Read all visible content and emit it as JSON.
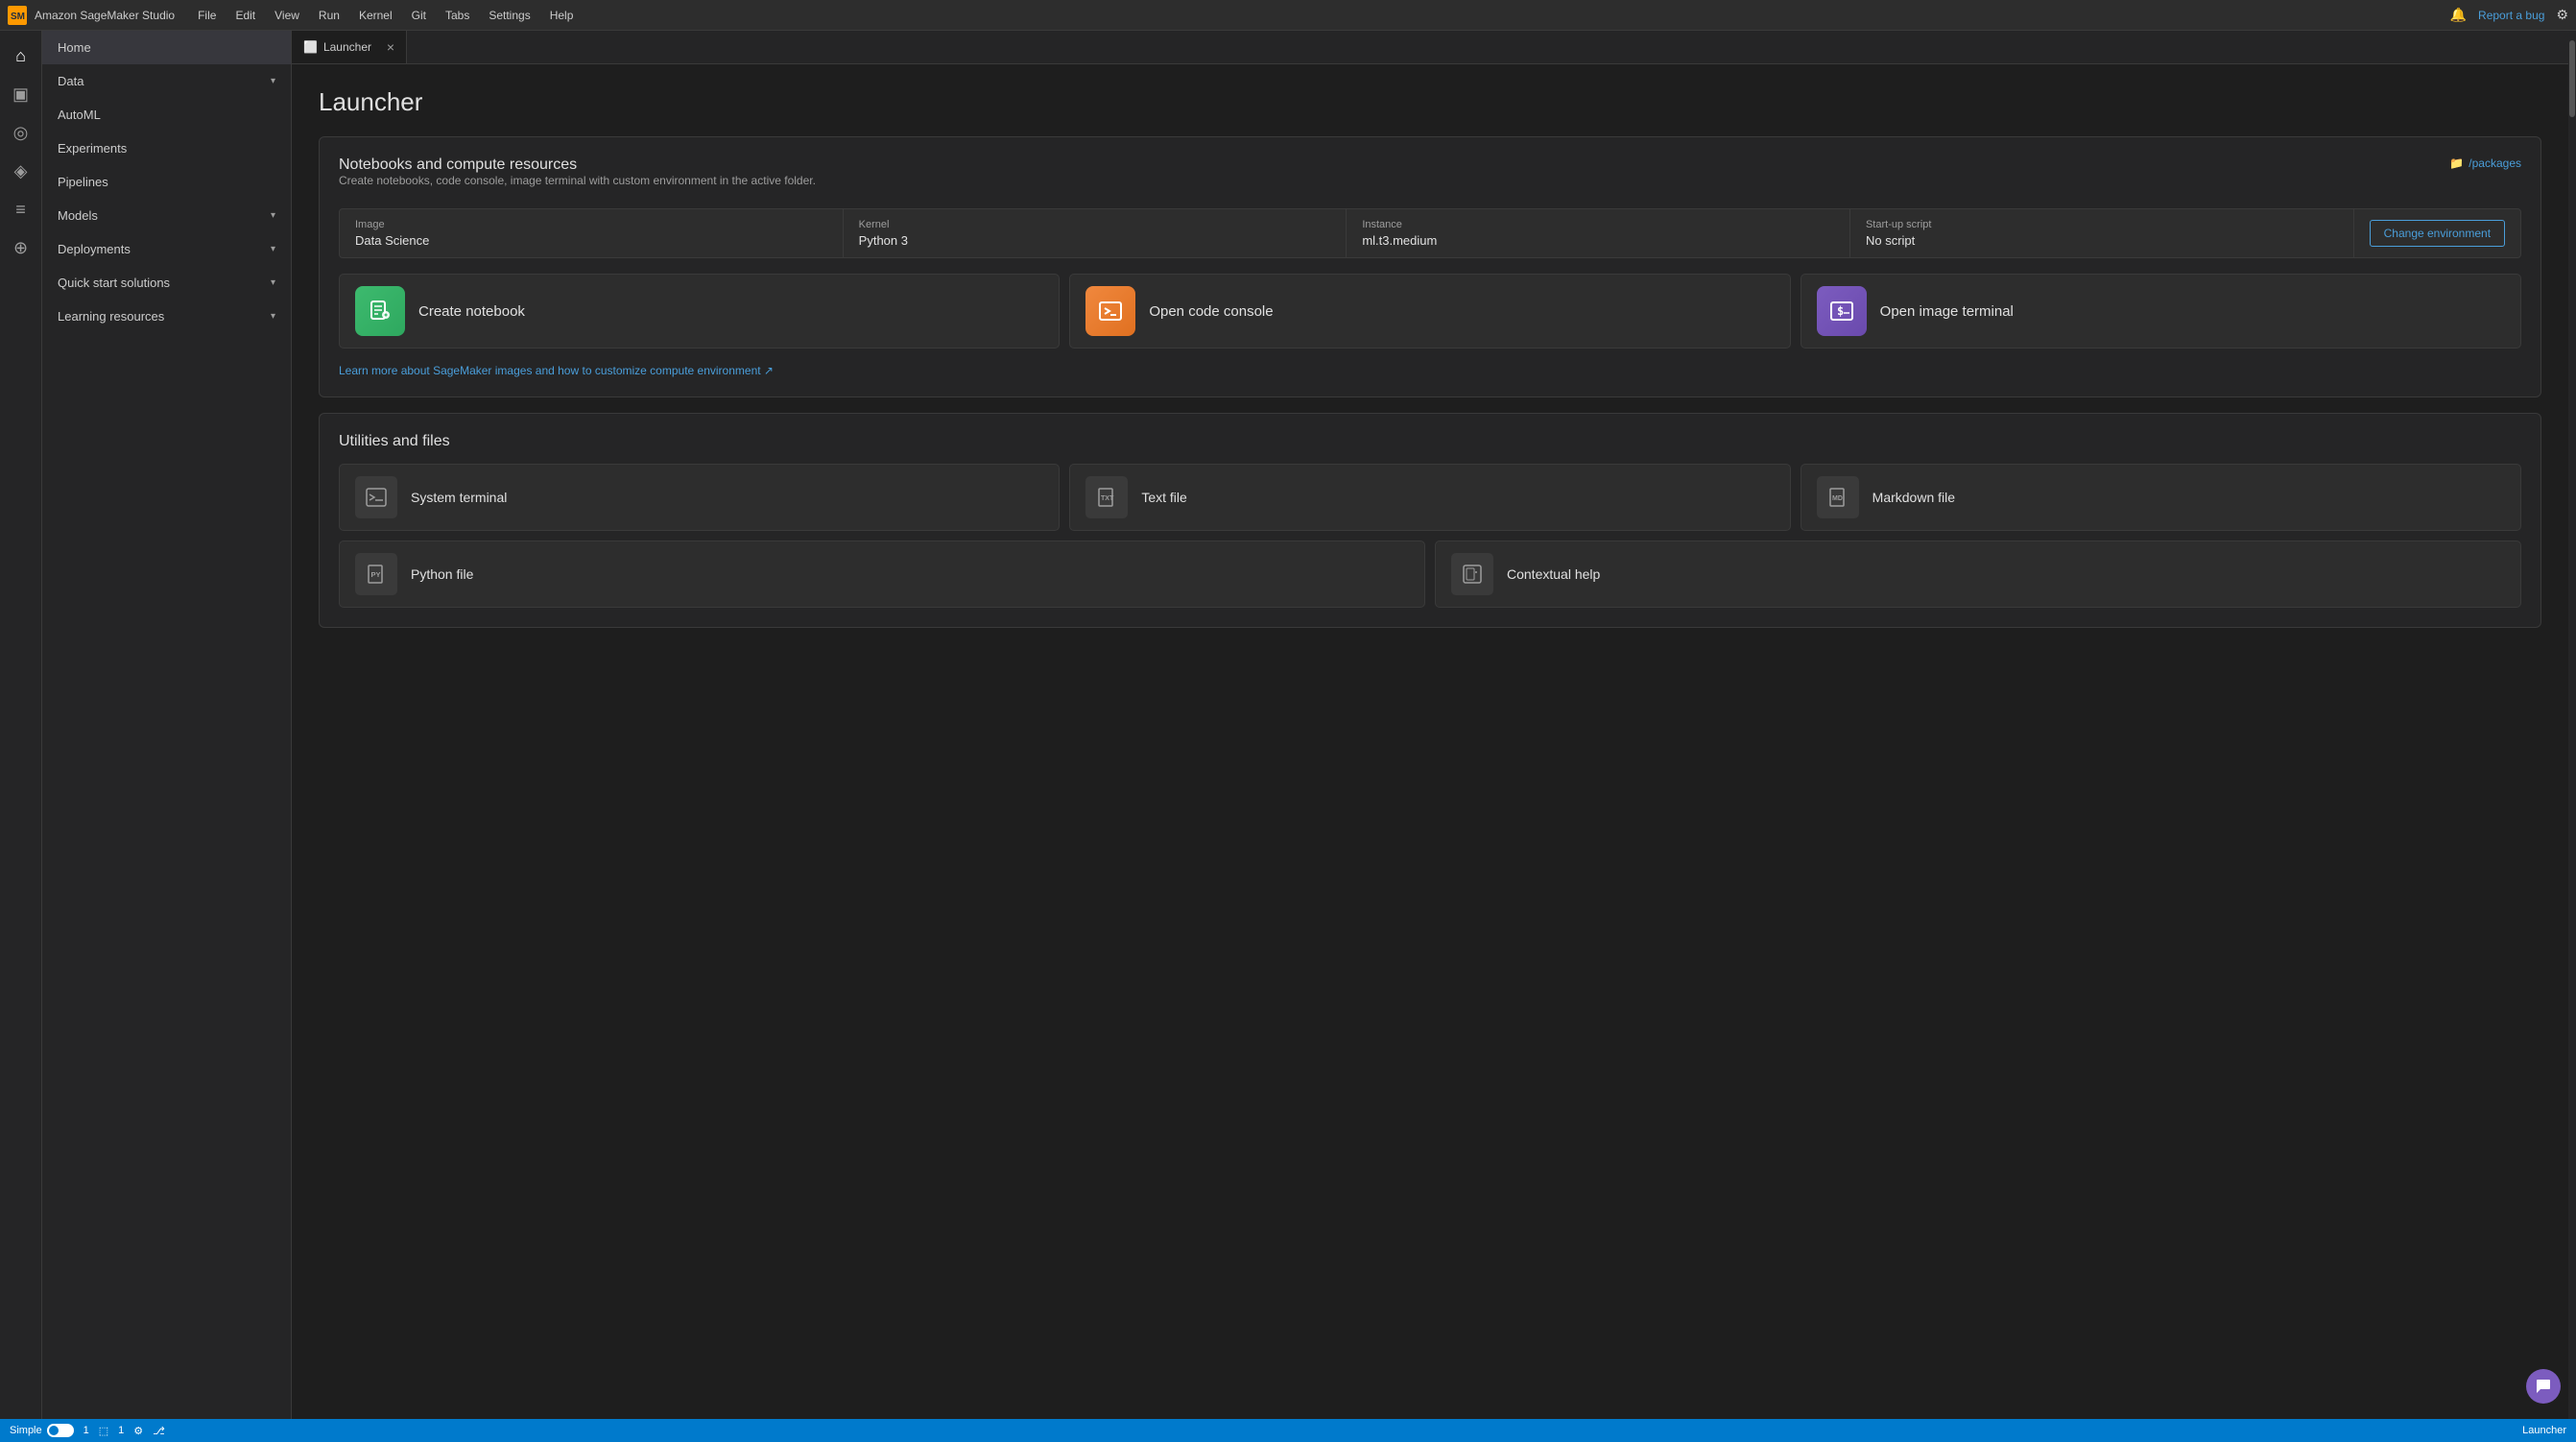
{
  "app": {
    "title": "Amazon SageMaker Studio",
    "report_bug": "Report a bug"
  },
  "menu": {
    "items": [
      "File",
      "Edit",
      "View",
      "Run",
      "Kernel",
      "Git",
      "Tabs",
      "Settings",
      "Help"
    ]
  },
  "sidebar": {
    "nav_items": [
      {
        "label": "Home",
        "icon": "⌂",
        "expandable": false
      },
      {
        "label": "Data",
        "icon": "▣",
        "expandable": true
      },
      {
        "label": "AutoML",
        "icon": "◎",
        "expandable": false
      },
      {
        "label": "Experiments",
        "icon": "◈",
        "expandable": false
      },
      {
        "label": "Pipelines",
        "icon": "≡",
        "expandable": false
      },
      {
        "label": "Models",
        "icon": "◧",
        "expandable": true
      },
      {
        "label": "Deployments",
        "icon": "◩",
        "expandable": true
      },
      {
        "label": "Quick start solutions",
        "icon": "⊕",
        "expandable": true
      },
      {
        "label": "Learning resources",
        "icon": "◫",
        "expandable": true
      }
    ]
  },
  "tab": {
    "icon": "⬜",
    "label": "Launcher",
    "close": "×"
  },
  "launcher": {
    "title": "Launcher",
    "notebooks_section": {
      "title": "Notebooks and compute resources",
      "subtitle": "Create notebooks, code console, image terminal with custom environment in the active folder.",
      "folder_label": "/packages",
      "environment": {
        "image_label": "Image",
        "image_value": "Data Science",
        "kernel_label": "Kernel",
        "kernel_value": "Python 3",
        "instance_label": "Instance",
        "instance_value": "ml.t3.medium",
        "startup_label": "Start-up script",
        "startup_value": "No script",
        "change_btn": "Change environment"
      },
      "actions": [
        {
          "label": "Create notebook",
          "icon_type": "green",
          "icon": "⊞"
        },
        {
          "label": "Open code console",
          "icon_type": "orange",
          "icon": "▶"
        },
        {
          "label": "Open image terminal",
          "icon_type": "purple",
          "icon": "$"
        }
      ],
      "learn_more": "Learn more about SageMaker images and how to customize compute environment ↗"
    },
    "utilities_section": {
      "title": "Utilities and files",
      "row1": [
        {
          "label": "System terminal",
          "icon": "⊞"
        },
        {
          "label": "Text file",
          "icon": "TXT"
        },
        {
          "label": "Markdown file",
          "icon": "MD"
        }
      ],
      "row2": [
        {
          "label": "Python file",
          "icon": "PY"
        },
        {
          "label": "Contextual help",
          "icon": "⊡"
        }
      ]
    }
  },
  "status_bar": {
    "mode_label": "Simple",
    "count1": "1",
    "count2": "1",
    "launcher_label": "Launcher"
  }
}
